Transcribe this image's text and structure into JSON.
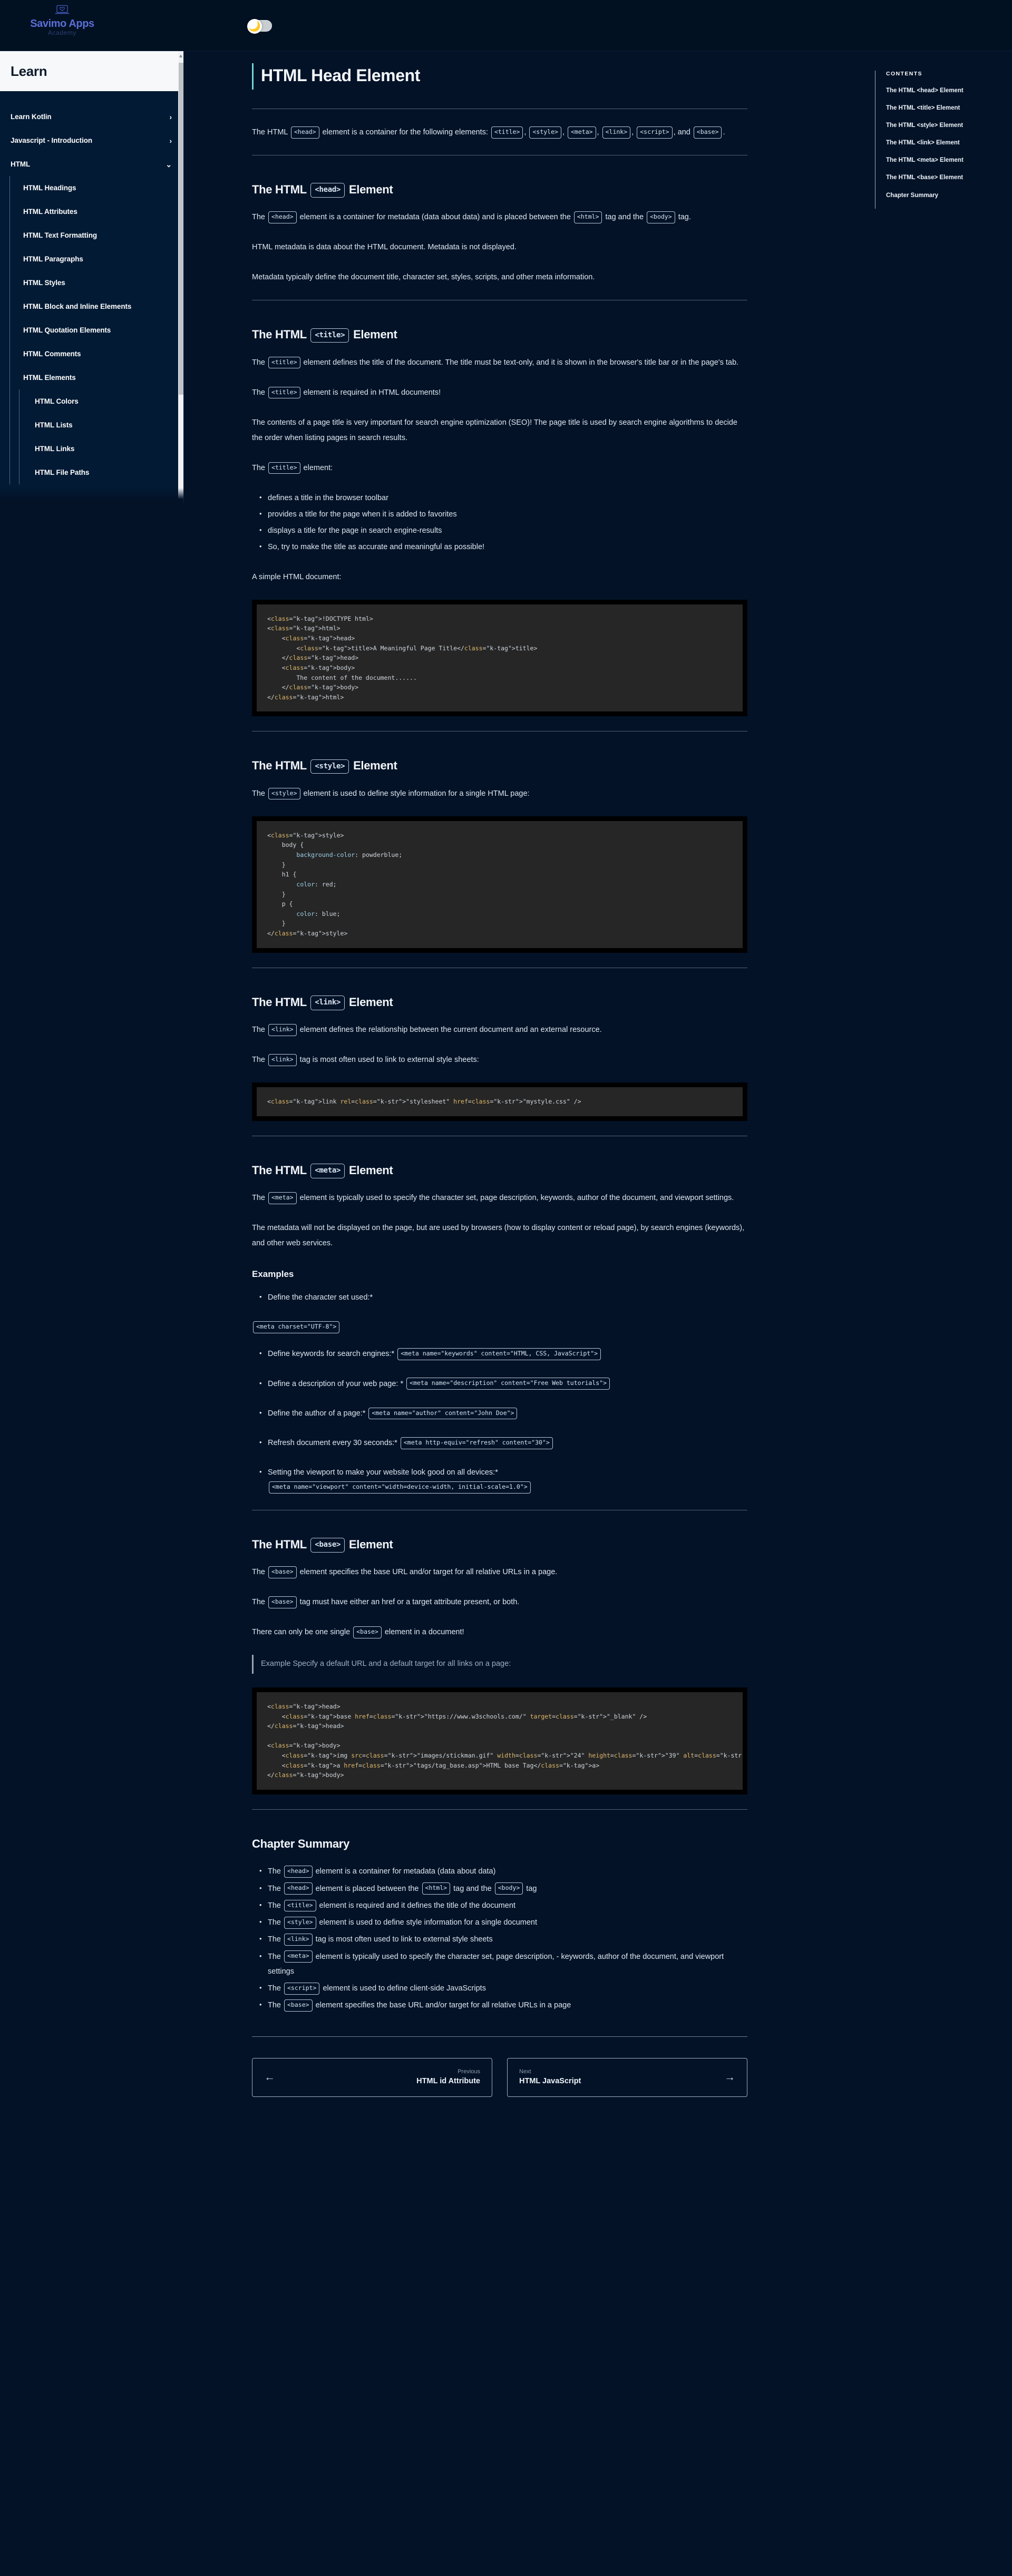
{
  "topbar": {
    "brand_name": "Savimo Apps",
    "brand_sub": "Academy",
    "brand_icon": "laptop-heart-icon",
    "theme_toggle_icon": "🌙"
  },
  "leftnav": {
    "heading": "Learn",
    "items": [
      {
        "label": "Learn Kotlin",
        "level": 0,
        "chevron": "›"
      },
      {
        "label": "Javascript - Introduction",
        "level": 0,
        "chevron": "›"
      },
      {
        "label": "HTML",
        "level": 0,
        "chevron": "⌄"
      },
      {
        "label": "HTML Headings",
        "level": 1,
        "chevron": ""
      },
      {
        "label": "HTML Attributes",
        "level": 1,
        "chevron": ""
      },
      {
        "label": "HTML Text Formatting",
        "level": 1,
        "chevron": ""
      },
      {
        "label": "HTML Paragraphs",
        "level": 1,
        "chevron": ""
      },
      {
        "label": "HTML Styles",
        "level": 1,
        "chevron": ""
      },
      {
        "label": "HTML Block and Inline Elements",
        "level": 1,
        "chevron": ""
      },
      {
        "label": "HTML Quotation Elements",
        "level": 1,
        "chevron": ""
      },
      {
        "label": "HTML Comments",
        "level": 1,
        "chevron": ""
      },
      {
        "label": "HTML Elements",
        "level": 1,
        "chevron": "⌄"
      },
      {
        "label": "HTML Colors",
        "level": 2,
        "chevron": ""
      },
      {
        "label": "HTML Lists",
        "level": 2,
        "chevron": ""
      },
      {
        "label": "HTML Links",
        "level": 2,
        "chevron": ""
      },
      {
        "label": "HTML File Paths",
        "level": 2,
        "chevron": ""
      }
    ]
  },
  "toc": {
    "heading": "CONTENTS",
    "items": [
      "The HTML <head> Element",
      "The HTML <title> Element",
      "The HTML <style> Element",
      "The HTML <link> Element",
      "The HTML <meta> Element",
      "The HTML <base> Element",
      "Chapter Summary"
    ]
  },
  "page": {
    "title": "HTML Head Element",
    "intro_a": "The HTML",
    "intro_head": "<head>",
    "intro_b": "element is a container for the following elements:",
    "intro_title": "<title>",
    "intro_style": "<style>",
    "intro_meta": "<meta>",
    "intro_link": "<link>",
    "intro_script": "<script>",
    "intro_and": ", and",
    "intro_base": "<base>",
    "intro_end": ".",
    "s1_h_a": "The HTML",
    "s1_h_tag": "<head>",
    "s1_h_b": "Element",
    "s1_p1_a": "The",
    "s1_p1_tag": "<head>",
    "s1_p1_b": "element is a container for metadata (data about data) and is placed between the",
    "s1_p1_html": "<html>",
    "s1_p1_c": "tag and the",
    "s1_p1_body": "<body>",
    "s1_p1_d": "tag.",
    "s1_p2": "HTML metadata is data about the HTML document. Metadata is not displayed.",
    "s1_p3": "Metadata typically define the document title, character set, styles, scripts, and other meta information.",
    "s2_h_a": "The HTML",
    "s2_h_tag": "<title>",
    "s2_h_b": "Element",
    "s2_p1_a": "The",
    "s2_p1_tag": "<title>",
    "s2_p1_b": "element defines the title of the document. The title must be text-only, and it is shown in the browser's title bar or in the page's tab.",
    "s2_p2_a": "The",
    "s2_p2_tag": "<title>",
    "s2_p2_b": "element is required in HTML documents!",
    "s2_p3": "The contents of a page title is very important for search engine optimization (SEO)! The page title is used by search engine algorithms to decide the order when listing pages in search results.",
    "s2_p4_a": "The",
    "s2_p4_tag": "<title>",
    "s2_p4_b": "element:",
    "s2_bullets": [
      "defines a title in the browser toolbar",
      "provides a title for the page when it is added to favorites",
      "displays a title for the page in search engine-results",
      "So, try to make the title as accurate and meaningful as possible!"
    ],
    "s2_p5": "A simple HTML document:",
    "s2_code": "<!DOCTYPE html>\n<html>\n    <head>\n        <title>A Meaningful Page Title</title>\n    </head>\n    <body>\n        The content of the document......\n    </body>\n</html>",
    "s3_h_a": "The HTML",
    "s3_h_tag": "<style>",
    "s3_h_b": "Element",
    "s3_p1_a": "The",
    "s3_p1_tag": "<style>",
    "s3_p1_b": "element is used to define style information for a single HTML page:",
    "s3_code": "<style>\n    body {\n        background-color: powderblue;\n    }\n    h1 {\n        color: red;\n    }\n    p {\n        color: blue;\n    }\n</style>",
    "s4_h_a": "The HTML",
    "s4_h_tag": "<link>",
    "s4_h_b": "Element",
    "s4_p1_a": "The",
    "s4_p1_tag": "<link>",
    "s4_p1_b": "element defines the relationship between the current document and an external resource.",
    "s4_p2_a": "The",
    "s4_p2_tag": "<link>",
    "s4_p2_b": "tag is most often used to link to external style sheets:",
    "s4_code": "<link rel=\"stylesheet\" href=\"mystyle.css\" />",
    "s5_h_a": "The HTML",
    "s5_h_tag": "<meta>",
    "s5_h_b": "Element",
    "s5_p1_a": "The",
    "s5_p1_tag": "<meta>",
    "s5_p1_b": "element is typically used to specify the character set, page description, keywords, author of the document, and viewport settings.",
    "s5_p2": "The metadata will not be displayed on the page, but are used by browsers (how to display content or reload page), by search engines (keywords), and other web services.",
    "s5_examples_h": "Examples",
    "s5_ex1_label": "Define the character set used:*",
    "s5_ex1_code": "<meta charset=\"UTF-8\">",
    "s5_ex2_label": "Define keywords for search engines:*",
    "s5_ex2_code": "<meta name=\"keywords\" content=\"HTML, CSS, JavaScript\">",
    "s5_ex3_label": "Define a description of your web page: *",
    "s5_ex3_code": "<meta name=\"description\" content=\"Free Web tutorials\">",
    "s5_ex4_label": "Define the author of a page:*",
    "s5_ex4_code": "<meta name=\"author\" content=\"John Doe\">",
    "s5_ex5_label": "Refresh document every 30 seconds:*",
    "s5_ex5_code": "<meta http-equiv=\"refresh\" content=\"30\">",
    "s5_ex6_label": "Setting the viewport to make your website look good on all devices:*",
    "s5_ex6_code": "<meta name=\"viewport\" content=\"width=device-width, initial-scale=1.0\">",
    "s6_h_a": "The HTML",
    "s6_h_tag": "<base>",
    "s6_h_b": "Element",
    "s6_p1_a": "The",
    "s6_p1_tag": "<base>",
    "s6_p1_b": "element specifies the base URL and/or target for all relative URLs in a page.",
    "s6_p2_a": "The",
    "s6_p2_tag": "<base>",
    "s6_p2_b": "tag must have either an href or a target attribute present, or both.",
    "s6_p3_a": "There can only be one single",
    "s6_p3_tag": "<base>",
    "s6_p3_b": "element in a document!",
    "s6_note": "Example Specify a default URL and a default target for all links on a page:",
    "s6_code": "<head>\n    <base href=\"https://www.w3schools.com/\" target=\"_blank\" />\n</head>\n\n<body>\n    <img src=\"images/stickman.gif\" width=\"24\" height=\"39\" alt=\"Stickman\" />\n    <a href=\"tags/tag_base.asp\">HTML base Tag</a>\n</body>",
    "summary_h": "Chapter Summary",
    "summary": [
      {
        "a": "The",
        "tag": "<head>",
        "b": "element is a container for metadata (data about data)",
        "tag2": "",
        "c": "",
        "tag3": "",
        "d": ""
      },
      {
        "a": "The",
        "tag": "<head>",
        "b": "element is placed between the",
        "tag2": "<html>",
        "c": "tag and the",
        "tag3": "<body>",
        "d": "tag"
      },
      {
        "a": "The",
        "tag": "<title>",
        "b": "element is required and it defines the title of the document",
        "tag2": "",
        "c": "",
        "tag3": "",
        "d": ""
      },
      {
        "a": "The",
        "tag": "<style>",
        "b": "element is used to define style information for a single document",
        "tag2": "",
        "c": "",
        "tag3": "",
        "d": ""
      },
      {
        "a": "The",
        "tag": "<link>",
        "b": "tag is most often used to link to external style sheets",
        "tag2": "",
        "c": "",
        "tag3": "",
        "d": ""
      },
      {
        "a": "The",
        "tag": "<meta>",
        "b": "element is typically used to specify the character set, page description, - keywords, author of the document, and viewport settings",
        "tag2": "",
        "c": "",
        "tag3": "",
        "d": ""
      },
      {
        "a": "The",
        "tag": "<script>",
        "b": "element is used to define client-side JavaScripts",
        "tag2": "",
        "c": "",
        "tag3": "",
        "d": ""
      },
      {
        "a": "The",
        "tag": "<base>",
        "b": "element specifies the base URL and/or target for all relative URLs in a page",
        "tag2": "",
        "c": "",
        "tag3": "",
        "d": ""
      }
    ]
  },
  "pager": {
    "prev_label": "Previous",
    "prev_title": "HTML id Attribute",
    "prev_arrow": "←",
    "next_label": "Next",
    "next_title": "HTML JavaScript",
    "next_arrow": "→"
  }
}
